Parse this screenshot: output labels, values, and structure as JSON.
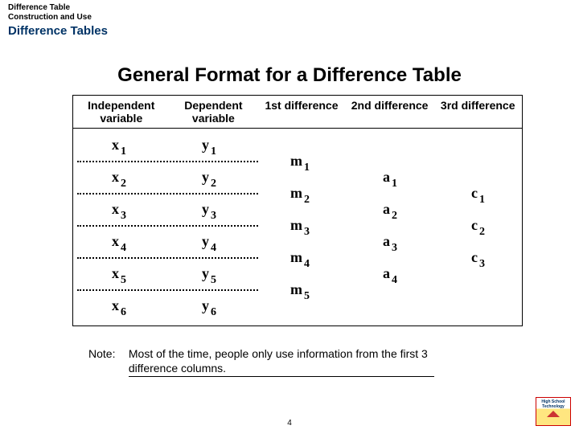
{
  "header": {
    "line1": "Difference Table",
    "line2": "Construction and Use",
    "section": "Difference Tables"
  },
  "title": "General Format for a Difference Table",
  "columns": {
    "c1": "Independent variable",
    "c2": "Dependent variable",
    "c3": "1st difference",
    "c4": "2nd difference",
    "c5": "3rd difference"
  },
  "x": {
    "sym": "x",
    "subs": [
      "1",
      "2",
      "3",
      "4",
      "5",
      "6"
    ]
  },
  "y": {
    "sym": "y",
    "subs": [
      "1",
      "2",
      "3",
      "4",
      "5",
      "6"
    ]
  },
  "m": {
    "sym": "m",
    "subs": [
      "1",
      "2",
      "3",
      "4",
      "5"
    ]
  },
  "a": {
    "sym": "a",
    "subs": [
      "1",
      "2",
      "3",
      "4"
    ]
  },
  "c": {
    "sym": "c",
    "subs": [
      "1",
      "2",
      "3"
    ]
  },
  "note": {
    "label": "Note:",
    "text": "Most of the time, people only use information from the first 3 difference columns."
  },
  "page": "4"
}
